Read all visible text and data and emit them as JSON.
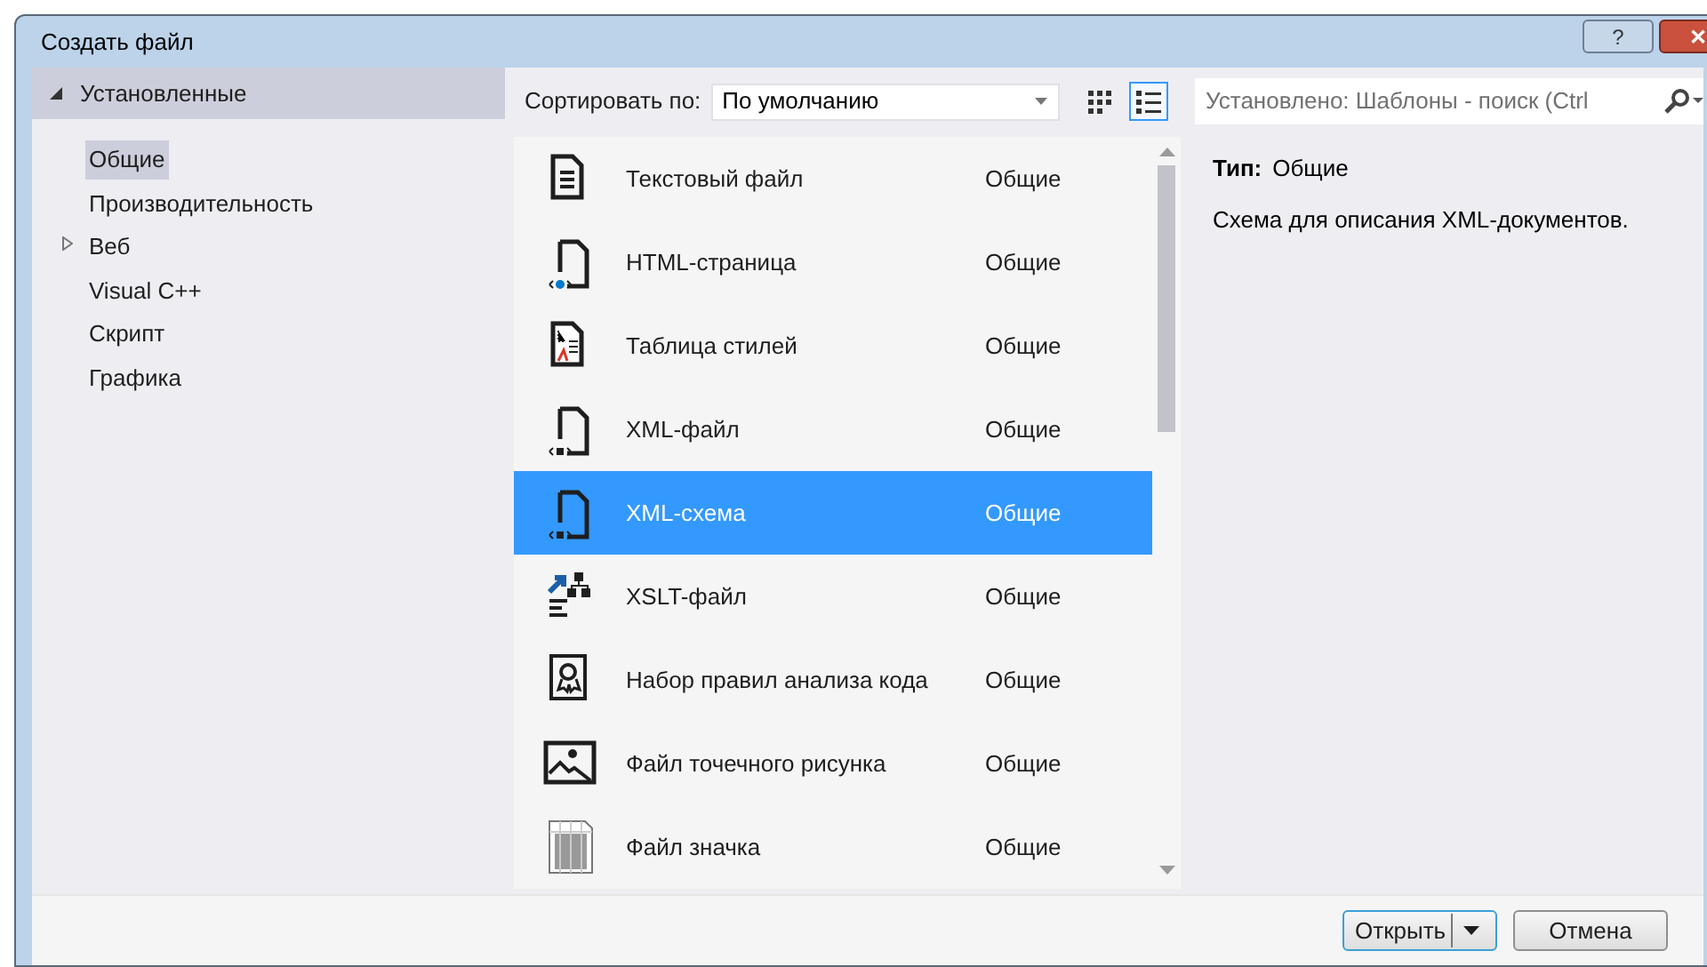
{
  "window": {
    "title": "Создать файл"
  },
  "title_buttons": [
    {
      "kind": "help",
      "label": "?"
    },
    {
      "kind": "close",
      "label": "✕"
    }
  ],
  "tree": {
    "label": "Установленные",
    "expanded": true,
    "children": [
      {
        "label": "Общие",
        "selected": true
      },
      {
        "label": "Производительность",
        "selected": false
      },
      {
        "label": "Веб",
        "selected": false,
        "expanded": false
      },
      {
        "label": "Visual C++",
        "selected": false
      },
      {
        "label": "Скрипт",
        "selected": false
      },
      {
        "label": "Графика",
        "selected": false
      }
    ]
  },
  "sort": {
    "label": "Сортировать по:",
    "value": "По умолчанию"
  },
  "view_buttons": [
    {
      "kind": "grid",
      "selected": false
    },
    {
      "kind": "list",
      "selected": true
    }
  ],
  "search": {
    "placeholder": "Установлено: Шаблоны - поиск (Ctrl"
  },
  "items": [
    {
      "kind": "text",
      "name": "Текстовый файл",
      "category": "Общие",
      "selected": false
    },
    {
      "kind": "html",
      "name": "HTML-страница",
      "category": "Общие",
      "selected": false
    },
    {
      "kind": "stylesheet",
      "name": "Таблица стилей",
      "category": "Общие",
      "selected": false
    },
    {
      "kind": "xml",
      "name": "XML-файл",
      "category": "Общие",
      "selected": false
    },
    {
      "kind": "xml",
      "name": "XML-схема",
      "category": "Общие",
      "selected": true
    },
    {
      "kind": "xslt",
      "name": "XSLT-файл",
      "category": "Общие",
      "selected": false
    },
    {
      "kind": "ruleset",
      "name": "Набор правил анализа кода",
      "category": "Общие",
      "selected": false
    },
    {
      "kind": "bitmap",
      "name": "Файл точечного рисунка",
      "category": "Общие",
      "selected": false
    },
    {
      "kind": "iconfile",
      "name": "Файл значка",
      "category": "Общие",
      "selected": false
    }
  ],
  "details": {
    "type_label": "Тип:",
    "type_value": "Общие",
    "description": "Схема для описания XML-документов."
  },
  "buttons": [
    {
      "kind": "split",
      "label": "Открыть",
      "default": true
    },
    {
      "kind": "plain",
      "label": "Отмена",
      "default": false
    }
  ]
}
